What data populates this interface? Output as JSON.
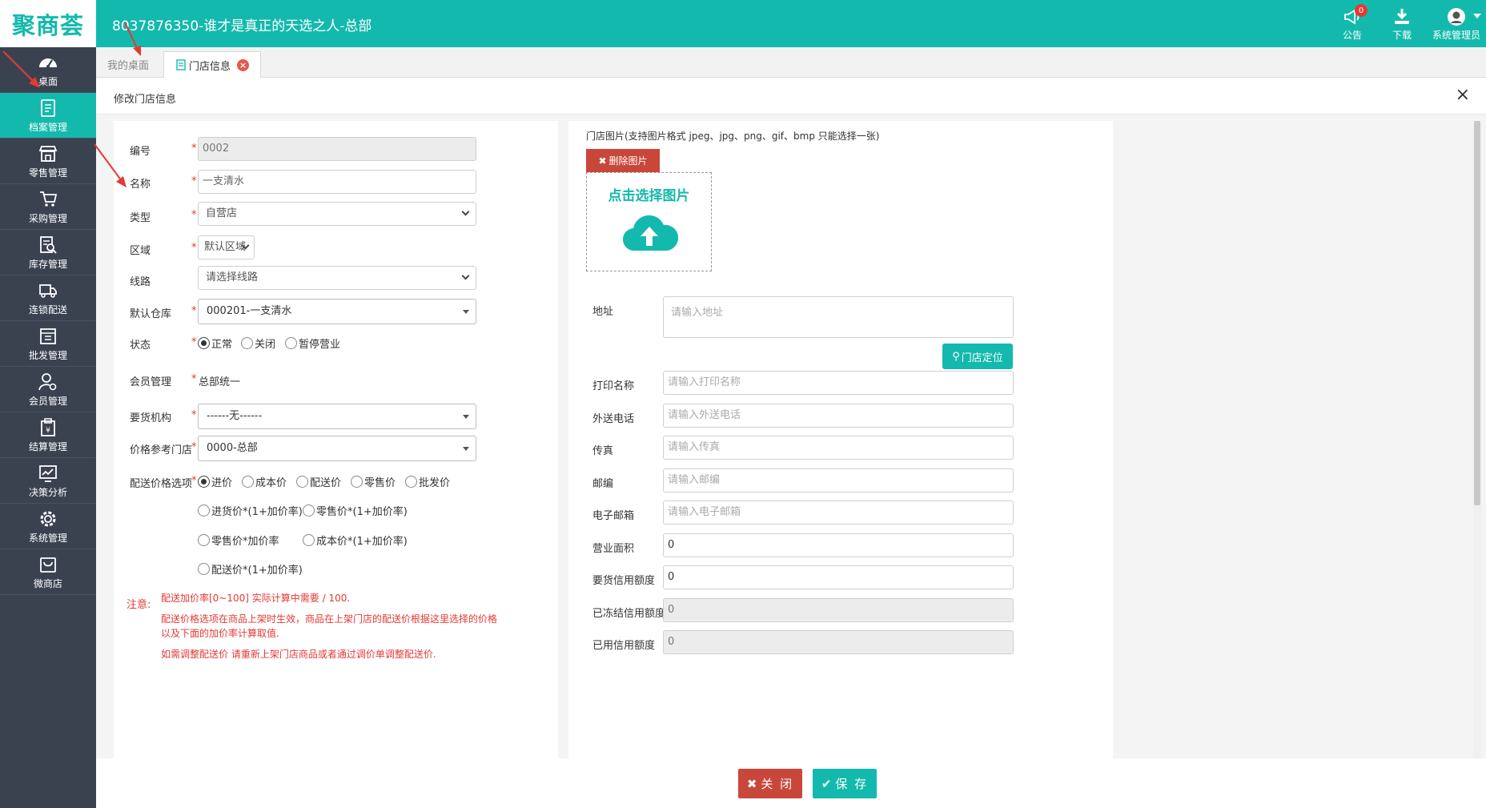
{
  "app": {
    "logo": "聚商荟",
    "title": "8037876350-谁才是真正的天选之人-总部"
  },
  "header_tools": {
    "notice_label": "公告",
    "notice_badge": "0",
    "download_label": "下载",
    "user_label": "系统管理员"
  },
  "sidebar": {
    "items": [
      {
        "label": "桌面",
        "icon": "dashboard-icon"
      },
      {
        "label": "档案管理",
        "icon": "archive-icon"
      },
      {
        "label": "零售管理",
        "icon": "store-icon"
      },
      {
        "label": "采购管理",
        "icon": "cart-icon"
      },
      {
        "label": "库存管理",
        "icon": "inventory-icon"
      },
      {
        "label": "连锁配送",
        "icon": "truck-icon"
      },
      {
        "label": "批发管理",
        "icon": "wholesale-icon"
      },
      {
        "label": "会员管理",
        "icon": "member-icon"
      },
      {
        "label": "结算管理",
        "icon": "settlement-icon"
      },
      {
        "label": "决策分析",
        "icon": "chart-icon"
      },
      {
        "label": "系统管理",
        "icon": "gear-icon"
      },
      {
        "label": "微商店",
        "icon": "bag-icon"
      }
    ],
    "active_index": 1
  },
  "tabs": [
    {
      "label": "我的桌面"
    },
    {
      "label": "门店信息",
      "close": "×"
    }
  ],
  "panel": {
    "title": "修改门店信息",
    "close": "×"
  },
  "form_left": {
    "code": {
      "label": "编号",
      "value": "0002"
    },
    "name": {
      "label": "名称",
      "value": "一支清水"
    },
    "type": {
      "label": "类型",
      "value": "自营店"
    },
    "region": {
      "label": "区域",
      "value": "默认区域"
    },
    "route": {
      "label": "线路",
      "value": "请选择线路"
    },
    "warehouse": {
      "label": "默认仓库",
      "value": "000201-一支清水"
    },
    "status": {
      "label": "状态",
      "options": [
        "正常",
        "关闭",
        "暂停营业"
      ],
      "selected": 0
    },
    "member": {
      "label": "会员管理",
      "value": "总部统一"
    },
    "supplier": {
      "label": "要货机构",
      "value": "------无------"
    },
    "price_ref": {
      "label": "价格参考门店",
      "value": "0000-总部"
    },
    "price_opt": {
      "label": "配送价格选项",
      "options": [
        "进价",
        "成本价",
        "配送价",
        "零售价",
        "批发价",
        "进货价*(1+加价率)",
        "零售价*(1+加价率)",
        "零售价*加价率",
        "成本价*(1+加价率)",
        "配送价*(1+加价率)"
      ],
      "selected": 0
    },
    "note_label": "注意:",
    "notes": [
      "配送加价率[0~100] 实际计算中需要 / 100.",
      "配送价格选项在商品上架时生效，商品在上架门店的配送价根据这里选择的价格",
      "以及下面的加价率计算取值.",
      "如需调整配送价 请重新上架门店商品或者通过调价单调整配送价."
    ]
  },
  "form_right": {
    "image_hint": "门店图片(支持图片格式 jpeg、jpg、png、gif、bmp 只能选择一张)",
    "delete_image": "删除图片",
    "pick_image": "点击选择图片",
    "address": {
      "label": "地址",
      "placeholder": "请输入地址"
    },
    "locate": "门店定位",
    "print_name": {
      "label": "打印名称",
      "placeholder": "请输入打印名称"
    },
    "phone": {
      "label": "外送电话",
      "placeholder": "请输入外送电话"
    },
    "fax": {
      "label": "传真",
      "placeholder": "请输入传真"
    },
    "postcode": {
      "label": "邮编",
      "placeholder": "请输入邮编"
    },
    "email": {
      "label": "电子邮箱",
      "placeholder": "请输入电子邮箱"
    },
    "area": {
      "label": "营业面积",
      "value": "0"
    },
    "credit": {
      "label": "要货信用额度",
      "value": "0"
    },
    "frozen": {
      "label": "已冻结信用额度",
      "value": "0"
    },
    "used": {
      "label": "已用信用额度",
      "value": "0"
    }
  },
  "footer": {
    "close": "关 闭",
    "save": "保 存"
  },
  "colors": {
    "accent": "#14b9ad",
    "danger": "#c9473a",
    "sidebar": "#3a4250",
    "annotation_arrow": "#e53935"
  }
}
